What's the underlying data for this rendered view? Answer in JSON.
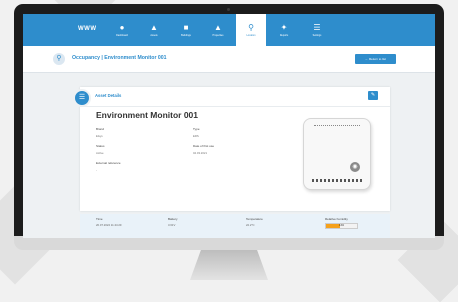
{
  "app": {
    "logo": "WWW",
    "nav": [
      {
        "label": "Dashboard",
        "icon": "pin-icon"
      },
      {
        "label": "Assets",
        "icon": "people-icon"
      },
      {
        "label": "Buildings",
        "icon": "building-icon"
      },
      {
        "label": "Properties",
        "icon": "property-icon"
      },
      {
        "label": "Location",
        "icon": "location-icon"
      },
      {
        "label": "Reports",
        "icon": "report-icon"
      },
      {
        "label": "Settings",
        "icon": "settings-icon"
      }
    ],
    "active_nav": 4
  },
  "header": {
    "title": "Occupancy | Environment Monitor 001",
    "return_label": "← Return to list"
  },
  "card": {
    "heading": "Asset Details",
    "asset_name": "Environment Monitor 001",
    "fields": {
      "brand_label": "Brand",
      "brand_value": "Elsys",
      "type_label": "Type",
      "type_value": "ERS",
      "status_label": "Status",
      "status_value": "Active",
      "date_label": "Date of first use",
      "date_value": "04.03.2021",
      "extref_label": "External reference",
      "extref_value": "-"
    }
  },
  "readings": {
    "time_label": "Time",
    "time_value": "20.07.2022 11:44:29",
    "battery_label": "Battery",
    "battery_value": "3.61V",
    "temperature_label": "Temperature",
    "temperature_value": "22.2°C",
    "humidity_label": "Relative humidity",
    "humidity_value": "44%",
    "humidity_level": 0.44
  },
  "colors": {
    "primary": "#2e8dcc",
    "humidity_bar": "#f5a11b"
  }
}
